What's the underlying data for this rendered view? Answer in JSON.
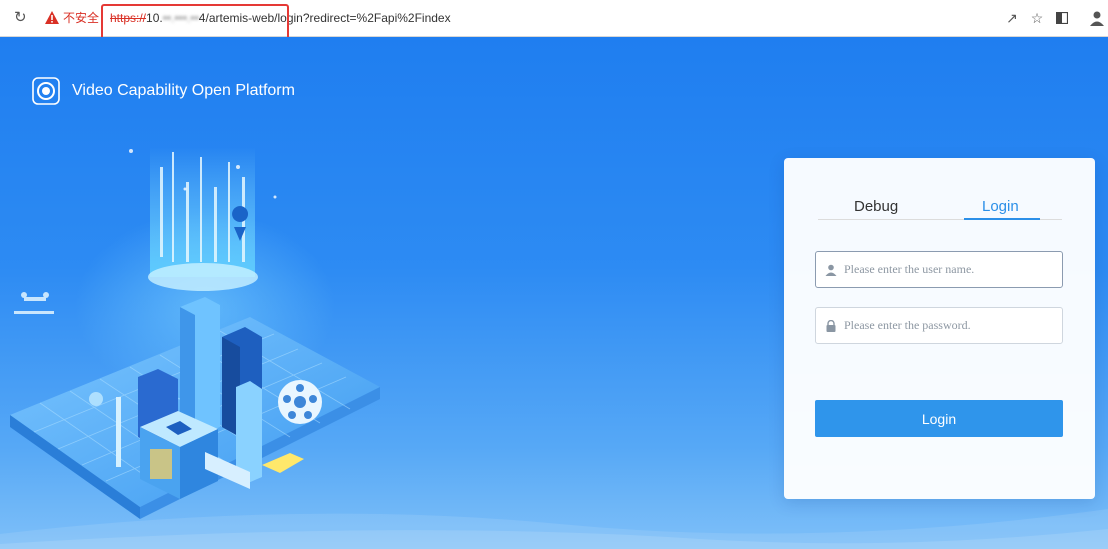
{
  "browser": {
    "insecure_label": "不安全",
    "url_protocol": "https://",
    "url_host_visible": "10.",
    "url_host_blurred": "••.•••.••",
    "url_host_tail": "4",
    "url_path": "/artemis-web/login?redirect=%2Fapi%2Findex"
  },
  "header": {
    "title": "Video Capability Open Platform"
  },
  "login": {
    "tabs": [
      {
        "label": "Debug",
        "active": false
      },
      {
        "label": "Login",
        "active": true
      }
    ],
    "username_placeholder": "Please enter the user name.",
    "password_placeholder": "Please enter the password.",
    "submit_label": "Login"
  },
  "icons": {
    "reload": "reload-icon",
    "warning": "warning-icon",
    "share": "share-icon",
    "bookmark": "star-icon",
    "sidepanel": "side-panel-icon",
    "user": "user-icon",
    "lock": "lock-icon"
  },
  "colors": {
    "accent": "#2b8fe8",
    "button": "#2f95eb",
    "background_top": "#1f7ef0",
    "background_bottom": "#7fc0f8",
    "warning": "#d93025",
    "highlight_box": "#e53935"
  }
}
